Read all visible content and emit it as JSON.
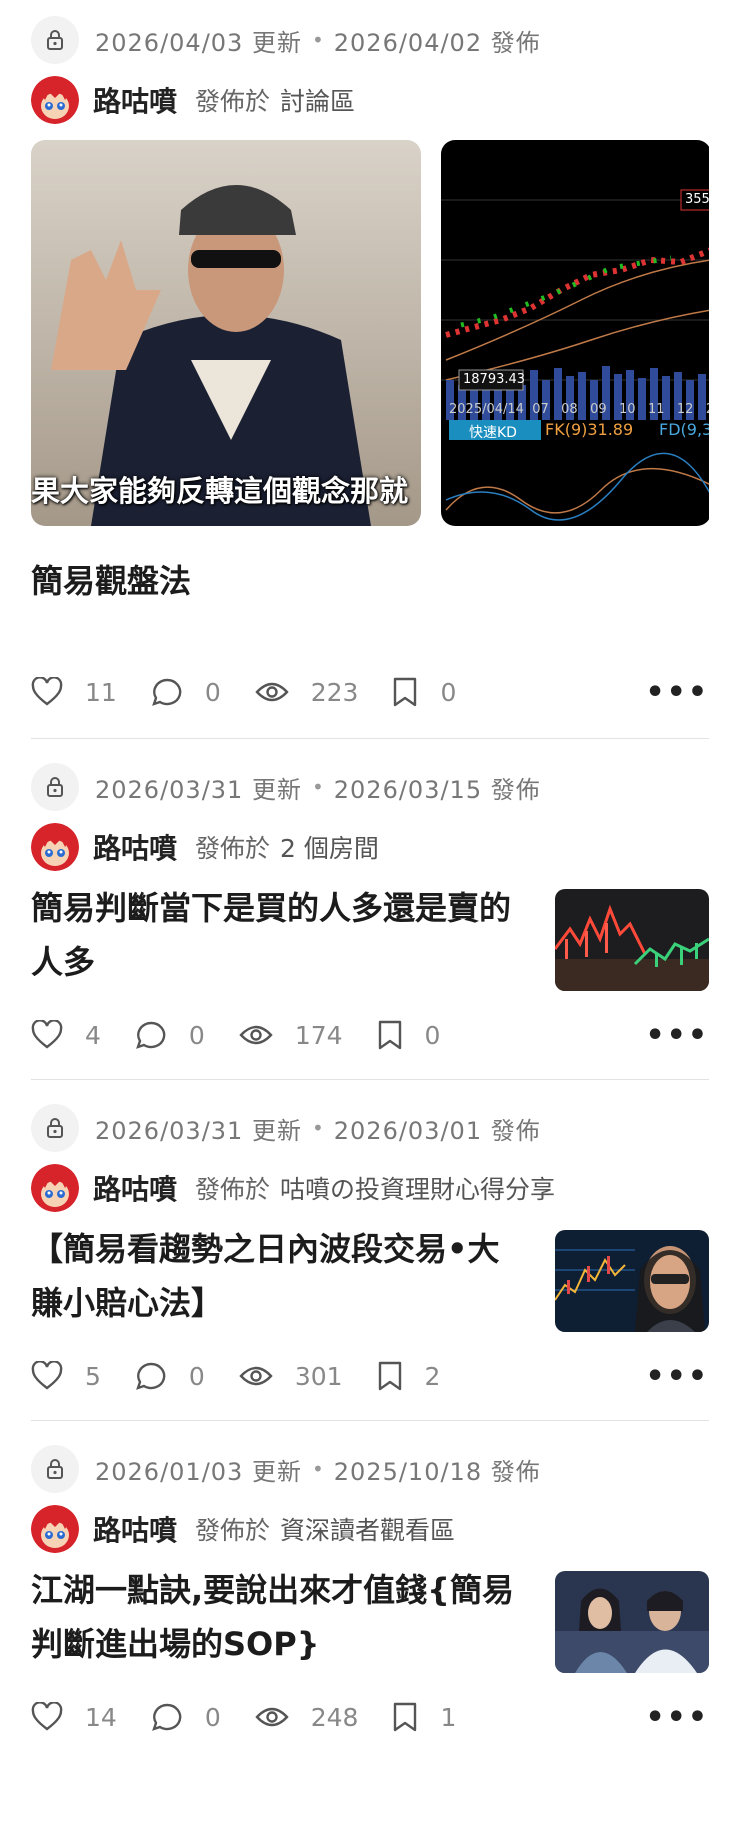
{
  "posts": [
    {
      "updated": "2026/04/03 更新",
      "published": "2026/04/02 發佈",
      "author": "路咕噴",
      "published_in_label": "發佈於",
      "space": "討論區",
      "title": "簡易觀盤法",
      "gallery": [
        {
          "caption": "果大家能夠反轉這個觀念那就"
        },
        {
          "price_tag": "355",
          "low_label": "18793.43",
          "dates": "2025/04/14  07   08   09   10   11   12   20",
          "kd_label": "快速KD",
          "fk": "FK(9)31.89",
          "fd": "FD(9,3"
        }
      ],
      "likes": "11",
      "comments": "0",
      "views": "223",
      "bookmarks": "0"
    },
    {
      "updated": "2026/03/31 更新",
      "published": "2026/03/15 發佈",
      "author": "路咕噴",
      "published_in_label": "發佈於",
      "space": "2 個房間",
      "title": "簡易判斷當下是買的人多還是賣的人多",
      "likes": "4",
      "comments": "0",
      "views": "174",
      "bookmarks": "0"
    },
    {
      "updated": "2026/03/31 更新",
      "published": "2026/03/01 發佈",
      "author": "路咕噴",
      "published_in_label": "發佈於",
      "space": "咕噴の投資理財心得分享",
      "title": "【簡易看趨勢之日內波段交易•大賺小賠心法】",
      "likes": "5",
      "comments": "0",
      "views": "301",
      "bookmarks": "2"
    },
    {
      "updated": "2026/01/03 更新",
      "published": "2025/10/18 發佈",
      "author": "路咕噴",
      "published_in_label": "發佈於",
      "space": "資深讀者觀看區",
      "title": "江湖一點訣,要說出來才值錢{簡易判斷進出場的SOP}",
      "likes": "14",
      "comments": "0",
      "views": "248",
      "bookmarks": "1"
    }
  ]
}
